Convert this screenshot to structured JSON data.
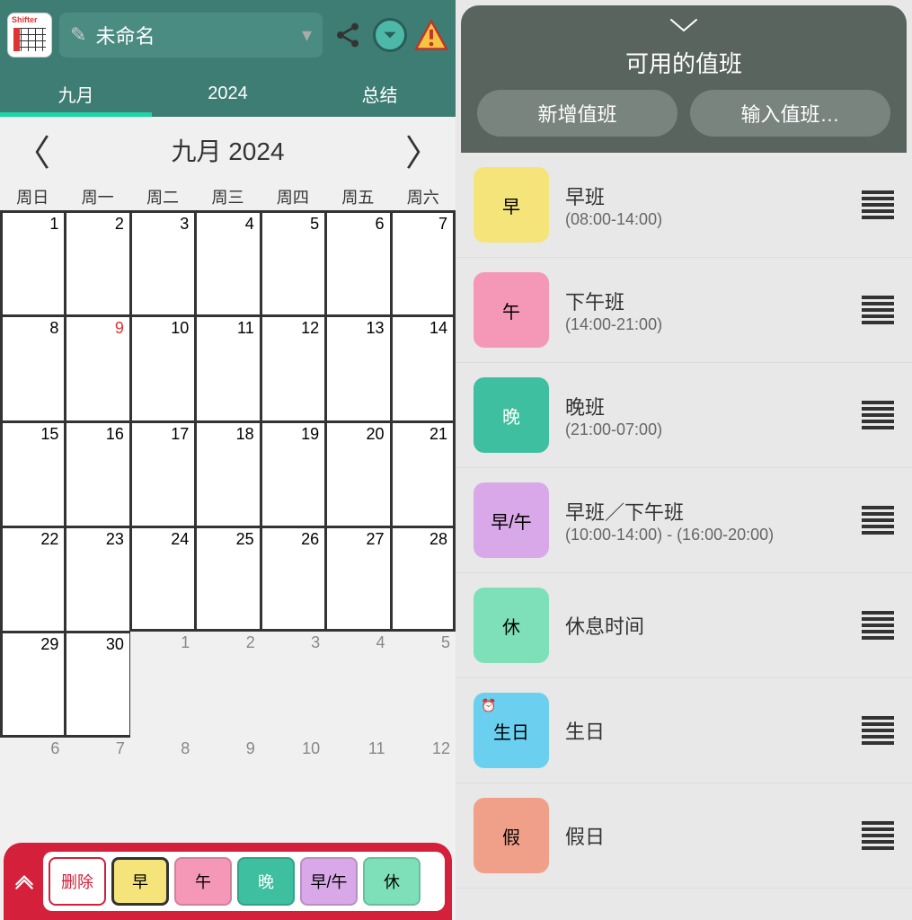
{
  "topbar": {
    "schedule_name": "未命名",
    "logo_text": "Shifter"
  },
  "tabs": {
    "month": "九月",
    "year": "2024",
    "summary": "总结"
  },
  "month_nav": {
    "title": "九月 2024"
  },
  "weekdays": [
    "周日",
    "周一",
    "周二",
    "周三",
    "周四",
    "周五",
    "周六"
  ],
  "calendar": {
    "today": 9,
    "cells": [
      {
        "d": 1,
        "in": true
      },
      {
        "d": 2,
        "in": true
      },
      {
        "d": 3,
        "in": true
      },
      {
        "d": 4,
        "in": true
      },
      {
        "d": 5,
        "in": true
      },
      {
        "d": 6,
        "in": true
      },
      {
        "d": 7,
        "in": true
      },
      {
        "d": 8,
        "in": true
      },
      {
        "d": 9,
        "in": true,
        "today": true
      },
      {
        "d": 10,
        "in": true
      },
      {
        "d": 11,
        "in": true
      },
      {
        "d": 12,
        "in": true
      },
      {
        "d": 13,
        "in": true
      },
      {
        "d": 14,
        "in": true
      },
      {
        "d": 15,
        "in": true
      },
      {
        "d": 16,
        "in": true
      },
      {
        "d": 17,
        "in": true
      },
      {
        "d": 18,
        "in": true
      },
      {
        "d": 19,
        "in": true
      },
      {
        "d": 20,
        "in": true
      },
      {
        "d": 21,
        "in": true
      },
      {
        "d": 22,
        "in": true
      },
      {
        "d": 23,
        "in": true
      },
      {
        "d": 24,
        "in": true
      },
      {
        "d": 25,
        "in": true
      },
      {
        "d": 26,
        "in": true
      },
      {
        "d": 27,
        "in": true
      },
      {
        "d": 28,
        "in": true
      },
      {
        "d": 29,
        "in": true
      },
      {
        "d": 30,
        "in": true
      },
      {
        "d": 1,
        "in": false
      },
      {
        "d": 2,
        "in": false
      },
      {
        "d": 3,
        "in": false
      },
      {
        "d": 4,
        "in": false
      },
      {
        "d": 5,
        "in": false
      },
      {
        "d": 6,
        "in": false
      },
      {
        "d": 7,
        "in": false
      },
      {
        "d": 8,
        "in": false
      },
      {
        "d": 9,
        "in": false
      },
      {
        "d": 10,
        "in": false
      },
      {
        "d": 11,
        "in": false
      },
      {
        "d": 12,
        "in": false
      }
    ]
  },
  "chipbar": {
    "delete": "删除",
    "chips": [
      {
        "label": "早",
        "color": "#f5e47a",
        "active": true
      },
      {
        "label": "午",
        "color": "#f598b8"
      },
      {
        "label": "晚",
        "color": "#3dbfa0",
        "text": "#fff"
      },
      {
        "label": "早/午",
        "color": "#d9a8e8"
      },
      {
        "label": "休",
        "color": "#7de0b8"
      }
    ]
  },
  "right": {
    "title": "可用的值班",
    "btn_add": "新增值班",
    "btn_input": "输入值班…",
    "shifts": [
      {
        "swatch": "早",
        "color": "#f5e47a",
        "name": "早班",
        "time": "(08:00-14:00)"
      },
      {
        "swatch": "午",
        "color": "#f598b8",
        "name": "下午班",
        "time": "(14:00-21:00)"
      },
      {
        "swatch": "晚",
        "color": "#3dbfa0",
        "text": "#fff",
        "name": "晚班",
        "time": "(21:00-07:00)"
      },
      {
        "swatch": "早/午",
        "color": "#d9a8e8",
        "name": "早班／下午班",
        "time": "(10:00-14:00) - (16:00-20:00)"
      },
      {
        "swatch": "休",
        "color": "#7de0b8",
        "name": "休息时间",
        "time": ""
      },
      {
        "swatch": "生日",
        "color": "#6bcff0",
        "name": "生日",
        "time": "",
        "clock": true
      },
      {
        "swatch": "假",
        "color": "#f0a088",
        "name": "假日",
        "time": ""
      }
    ]
  }
}
